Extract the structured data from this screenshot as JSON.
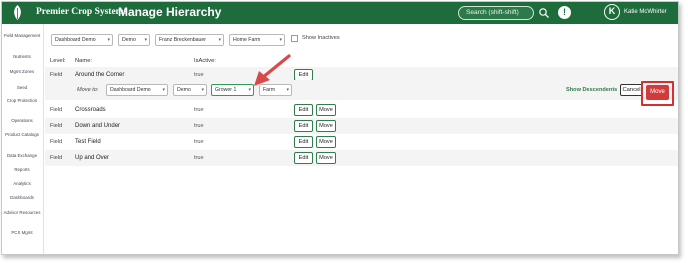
{
  "header": {
    "brand": "Premier Crop Systems",
    "page_title": "Manage Hierarchy",
    "search_placeholder": "Search (shift-shift)",
    "alert_glyph": "!",
    "avatar_initial": "K",
    "user_name": "Katie McWhirter",
    "brand_color": "#1e6b3c"
  },
  "sidebar": {
    "items": [
      "Field Management",
      "Nutrients",
      "Mgmt Zones",
      "Seed",
      "Crop Protection",
      "Operations",
      "Product Catalogs",
      "Data Exchange",
      "Reports",
      "Analytics",
      "Dashboards",
      "Advisor Resources",
      "PCS Mgmt"
    ]
  },
  "filters": {
    "dashboard": "Dashboard Demo",
    "demo": "Demo",
    "grower": "Franz Breckenbauer",
    "farm": "Home Farm",
    "show_inactives": "Show Inactives"
  },
  "table": {
    "headers": {
      "level": "Level:",
      "name": "Name:",
      "active": "IsActive:"
    },
    "rows": [
      {
        "level": "Field",
        "name": "Around the Corner",
        "active": "true"
      },
      {
        "level": "Field",
        "name": "Crossroads",
        "active": "true"
      },
      {
        "level": "Field",
        "name": "Down and Under",
        "active": "true"
      },
      {
        "level": "Field",
        "name": "Test Field",
        "active": "true"
      },
      {
        "level": "Field",
        "name": "Up and Over",
        "active": "true"
      }
    ],
    "edit_label": "Edit",
    "move_label": "Move"
  },
  "move_panel": {
    "label": "Move to:",
    "dashboard": "Dashboard Demo",
    "demo": "Demo",
    "grower": "Grower 1",
    "farm": "Farm",
    "show_descendents": "Show Descendents",
    "cancel": "Cancel",
    "move": "Move",
    "highlight_color": "#d52f2f"
  }
}
